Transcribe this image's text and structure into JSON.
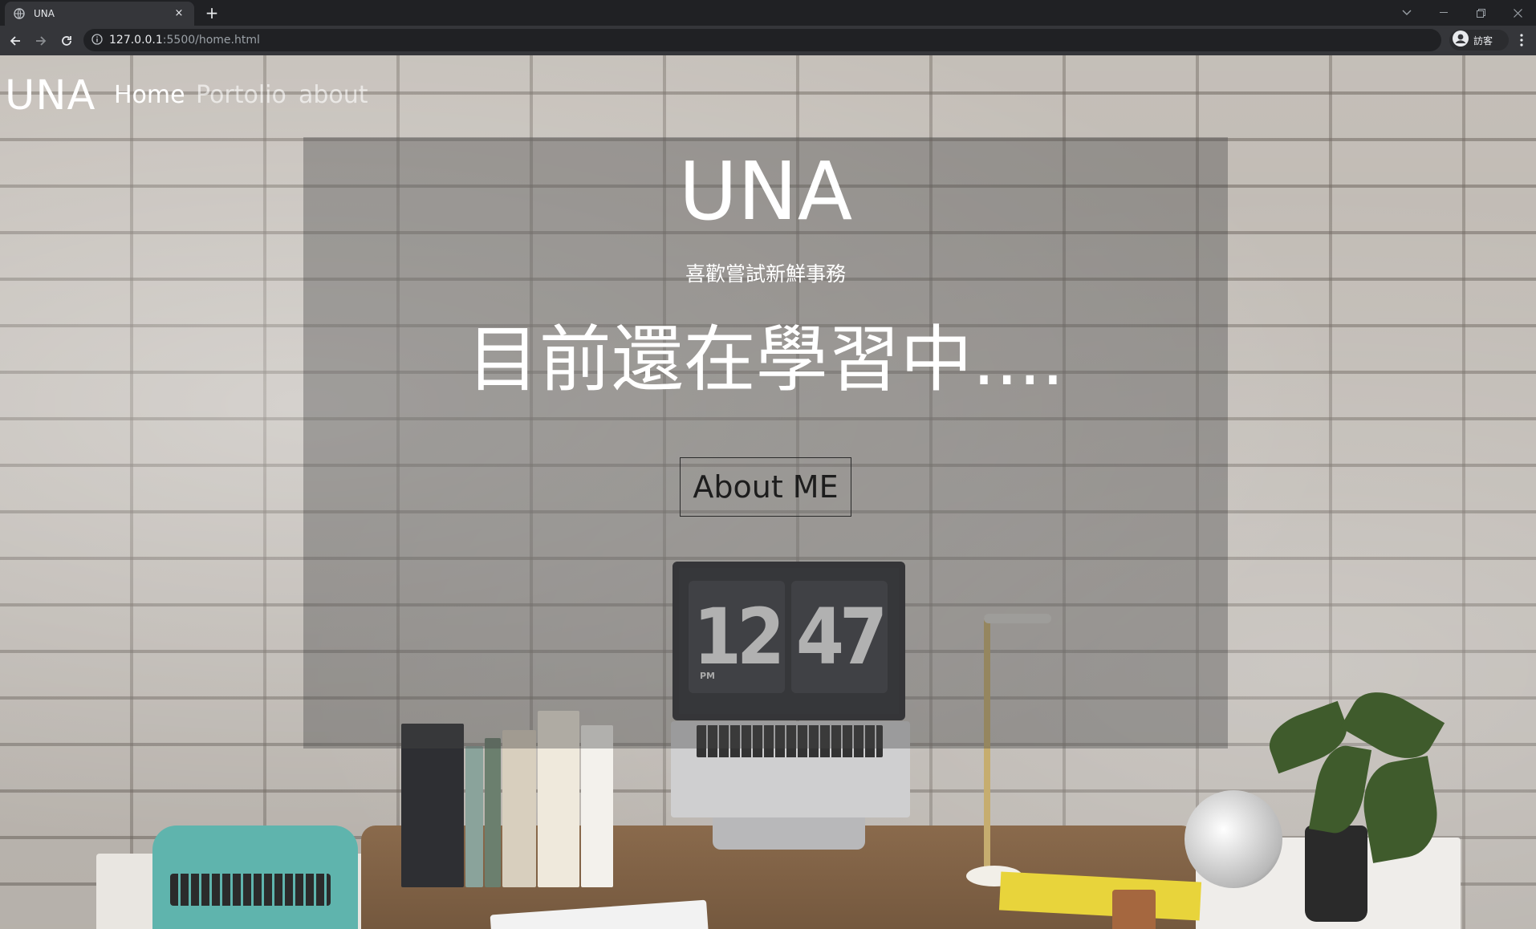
{
  "browser": {
    "tab_title": "UNA",
    "tab_close": "×",
    "new_tab": "+",
    "url_host": "127.0.0.1",
    "url_path": ":5500/home.html",
    "profile_label": "訪客"
  },
  "site": {
    "brand": "UNA",
    "nav": {
      "home": "Home",
      "portolio": "Portolio",
      "about": "about"
    },
    "hero": {
      "title": "UNA",
      "subtitle": "喜歡嘗試新鮮事務",
      "lead": "目前還在學習中....",
      "button": "About ME"
    }
  },
  "background_scene": {
    "clock_hours": "12",
    "clock_minutes": "47",
    "clock_period": "PM"
  }
}
